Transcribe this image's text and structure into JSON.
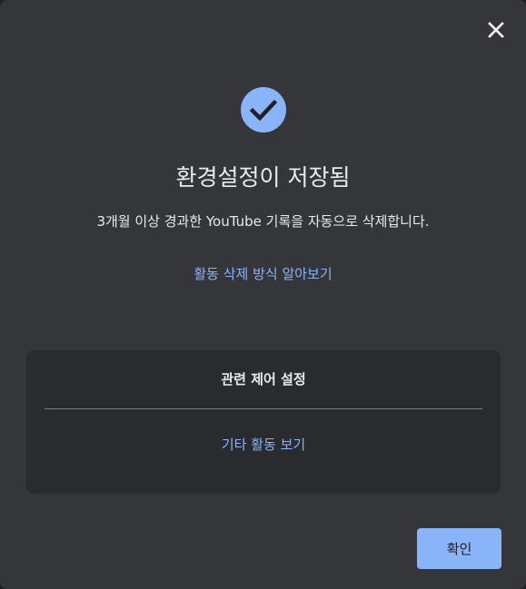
{
  "dialog": {
    "close_icon": "close-icon",
    "status_icon": "check-circle-icon",
    "title": "환경설정이 저장됨",
    "description": "3개월 이상 경과한 YouTube 기록을 자동으로 삭제합니다.",
    "learn_link": "활동 삭제 방식 알아보기",
    "related": {
      "title": "관련 제어 설정",
      "link": "기타 활동 보기"
    },
    "confirm_label": "확인"
  },
  "colors": {
    "background": "#35363a",
    "card": "#2a2b2e",
    "accent": "#8ab4f8",
    "text": "#e8eaed"
  }
}
